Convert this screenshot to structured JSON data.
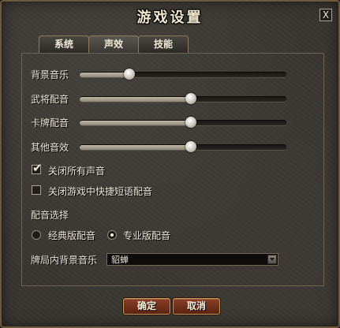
{
  "dialog": {
    "title": "游戏设置",
    "close_label": "X"
  },
  "tabs": [
    {
      "label": "系统",
      "active": false
    },
    {
      "label": "声效",
      "active": true
    },
    {
      "label": "技能",
      "active": false
    }
  ],
  "sliders": [
    {
      "label": "背景音乐",
      "value": 0.24
    },
    {
      "label": "武将配音",
      "value": 0.54
    },
    {
      "label": "卡牌配音",
      "value": 0.54
    },
    {
      "label": "其他音效",
      "value": 0.54
    }
  ],
  "checkboxes": [
    {
      "label": "关闭所有声音",
      "checked": true
    },
    {
      "label": "关闭游戏中快捷短语配音",
      "checked": false
    }
  ],
  "voice_select": {
    "heading": "配音选择",
    "options": [
      {
        "label": "经典版配音",
        "selected": false
      },
      {
        "label": "专业版配音",
        "selected": true
      }
    ]
  },
  "bgm": {
    "label": "牌局内背景音乐",
    "value": "貂蝉"
  },
  "buttons": {
    "ok": "确定",
    "cancel": "取消"
  }
}
